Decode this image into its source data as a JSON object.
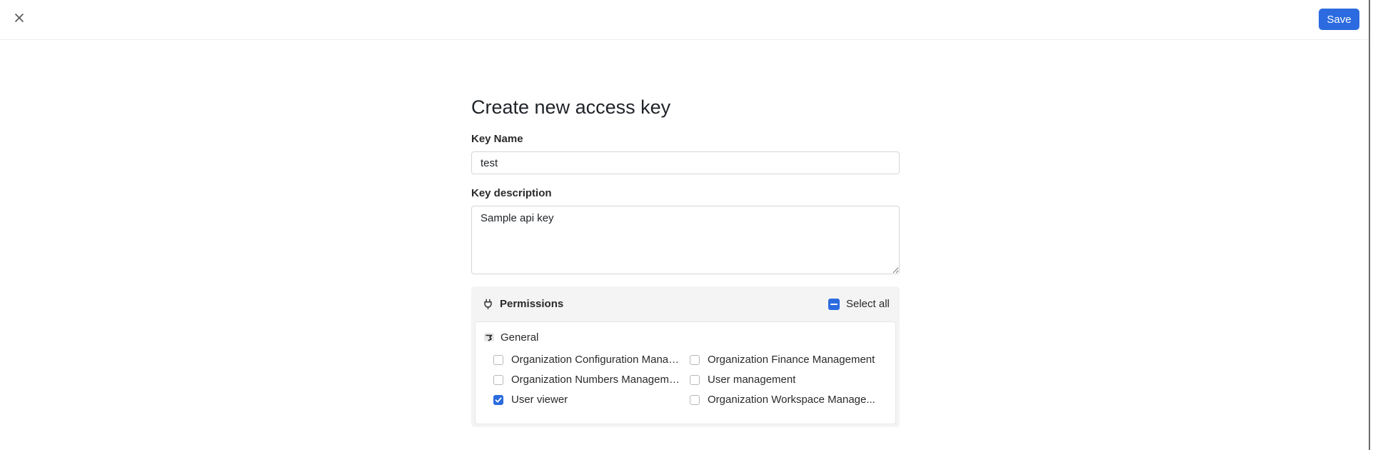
{
  "header": {
    "close_icon": "close-icon",
    "save_label": "Save",
    "accent_color": "#2b6bdf"
  },
  "form": {
    "title": "Create new access key",
    "key_name": {
      "label": "Key Name",
      "value": "test"
    },
    "key_description": {
      "label": "Key description",
      "value": "Sample api key"
    }
  },
  "permissions": {
    "title": "Permissions",
    "icon": "plug-icon",
    "select_all_label": "Select all",
    "select_all_state": "indeterminate",
    "groups": [
      {
        "title": "General",
        "icon": "group-icon",
        "items": [
          {
            "label": "Organization Configuration Manag...",
            "checked": false
          },
          {
            "label": "Organization Finance Management",
            "checked": false
          },
          {
            "label": "Organization Numbers Management",
            "checked": false
          },
          {
            "label": "User management",
            "checked": false
          },
          {
            "label": "User viewer",
            "checked": true
          },
          {
            "label": "Organization Workspace Manage...",
            "checked": false
          }
        ]
      }
    ]
  }
}
